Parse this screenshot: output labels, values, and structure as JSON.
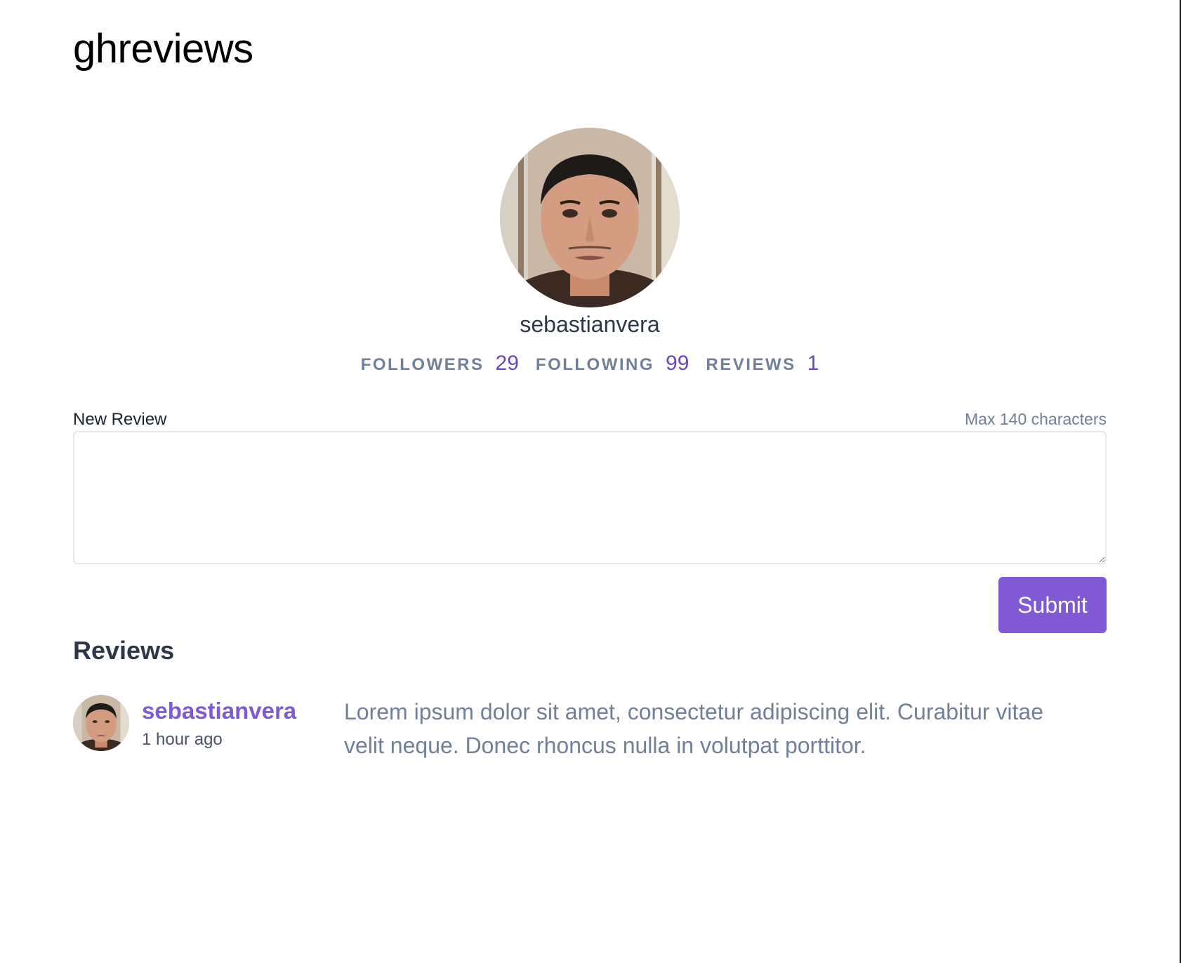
{
  "app": {
    "title": "ghreviews"
  },
  "profile": {
    "avatar_icon": "user-avatar-photo",
    "username": "sebastianvera",
    "stats": [
      {
        "label": "FOLLOWERS",
        "value": "29"
      },
      {
        "label": "FOLLOWING",
        "value": "99"
      },
      {
        "label": "REVIEWS",
        "value": "1"
      }
    ]
  },
  "form": {
    "label": "New Review",
    "hint": "Max 140 characters",
    "value": "",
    "submit_label": "Submit"
  },
  "reviews": {
    "heading": "Reviews",
    "items": [
      {
        "avatar_icon": "user-avatar-photo",
        "author": "sebastianvera",
        "time": "1 hour ago",
        "body": "Lorem ipsum dolor sit amet, consectetur adipiscing elit. Curabitur vitae velit neque. Donec rhoncus nulla in volutpat porttitor."
      }
    ]
  },
  "colors": {
    "accent": "#805ad5",
    "stat_value": "#6b46c1",
    "muted_text": "#718096",
    "heading_text": "#2d3748"
  }
}
